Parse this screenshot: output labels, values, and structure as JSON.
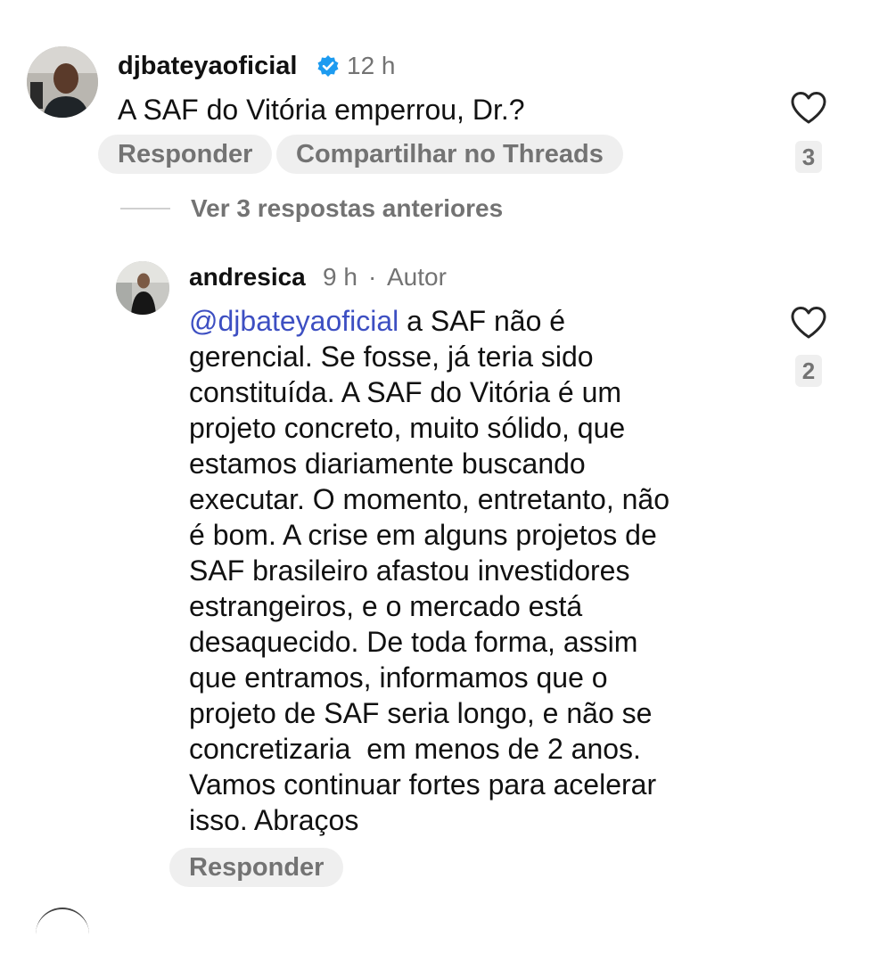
{
  "comment": {
    "username": "djbateyaoficial",
    "verified_icon": "verified-badge-icon",
    "time": "12 h",
    "text": "A SAF do Vitória emperrou, Dr.?",
    "reply_label": "Responder",
    "share_label": "Compartilhar no Threads",
    "like_count": "3",
    "like_icon": "heart-outline-icon"
  },
  "replies_toggle": {
    "label": "Ver 3 respostas anteriores"
  },
  "reply": {
    "username": "andresica",
    "time": "9 h",
    "separator": "·",
    "author_label": "Autor",
    "mention": "@djbateyaoficial",
    "lines": [
      " a SAF não é",
      "gerencial. Se fosse, já teria sido",
      "constituída. A SAF do Vitória é um",
      "projeto concreto, muito sólido, que",
      "estamos diariamente buscando",
      "executar. O momento, entretanto, não",
      "é bom. A crise em alguns projetos de",
      "SAF brasileiro afastou investidores",
      "estrangeiros, e o mercado está",
      "desaquecido. De toda forma, assim",
      "que entramos, informamos que o",
      "projeto de SAF seria longo, e não se",
      "concretizaria  em menos de 2 anos.",
      "Vamos continuar fortes para acelerar",
      "isso. Abraços"
    ],
    "reply_label": "Responder",
    "like_count": "2",
    "like_icon": "heart-outline-icon"
  },
  "colors": {
    "verified_blue": "#1d9bf0",
    "mention_blue": "#3d4fc2",
    "muted_gray": "#737373",
    "pill_bg": "#efefef"
  }
}
